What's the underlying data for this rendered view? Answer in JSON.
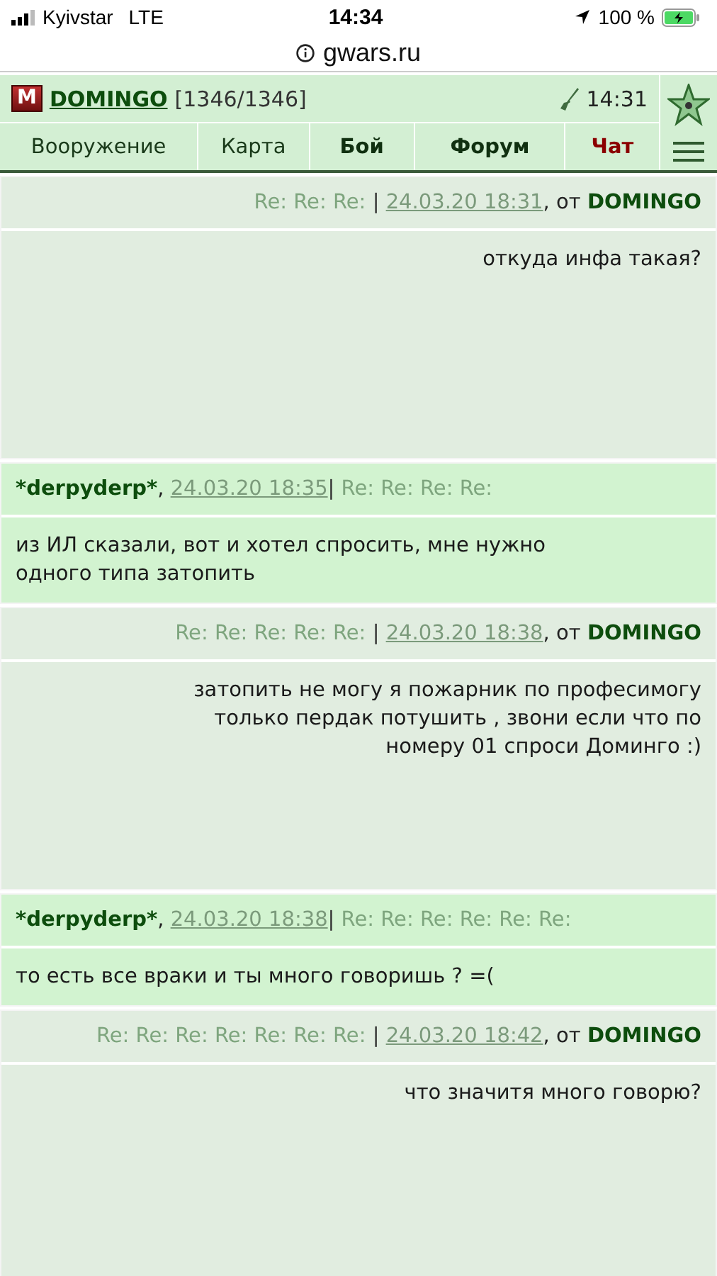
{
  "status_bar": {
    "carrier": "Kyivstar",
    "network": "LTE",
    "time": "14:34",
    "battery": "100 %"
  },
  "address_bar": {
    "url": "gwars.ru"
  },
  "header": {
    "logo": "M",
    "user": "DOMINGO",
    "hp": "[1346/1346]",
    "clock": "14:31"
  },
  "nav": [
    {
      "label": "Вооружение",
      "kind": "plain"
    },
    {
      "label": "Карта",
      "kind": "plain"
    },
    {
      "label": "Бой",
      "kind": "bold"
    },
    {
      "label": "Форум",
      "kind": "bold"
    },
    {
      "label": "Чат",
      "kind": "alert"
    }
  ],
  "messages": [
    {
      "kind": "mine",
      "meta": [
        {
          "kind": "subject",
          "text": "Re: Re: Re:"
        },
        {
          "kind": "sep",
          "text": "|"
        },
        {
          "kind": "date",
          "text": "24.03.20 18:31"
        },
        {
          "kind": "text",
          "text": ", от"
        },
        {
          "kind": "author",
          "text": "DOMINGO"
        }
      ],
      "body": "откуда инфа такая?"
    },
    {
      "kind": "other",
      "meta": [
        {
          "kind": "author",
          "text": "*derpyderp*"
        },
        {
          "kind": "text",
          "text": ","
        },
        {
          "kind": "date",
          "text": "24.03.20 18:35"
        },
        {
          "kind": "sep",
          "text": "|"
        },
        {
          "kind": "subject",
          "text": "Re: Re: Re: Re:"
        }
      ],
      "body": "из ИЛ сказали, вот и хотел спросить, мне нужно одного типа затопить"
    },
    {
      "kind": "mine",
      "meta": [
        {
          "kind": "subject",
          "text": "Re: Re: Re: Re: Re:"
        },
        {
          "kind": "sep",
          "text": "|"
        },
        {
          "kind": "date",
          "text": "24.03.20 18:38"
        },
        {
          "kind": "text",
          "text": ", от"
        },
        {
          "kind": "author",
          "text": "DOMINGO"
        }
      ],
      "body": "затопить не могу я пожарник по професимогу только пердак потушить , звони если что по номеру 01 спроси Доминго :)"
    },
    {
      "kind": "other",
      "meta": [
        {
          "kind": "author",
          "text": "*derpyderp*"
        },
        {
          "kind": "text",
          "text": ","
        },
        {
          "kind": "date",
          "text": "24.03.20 18:38"
        },
        {
          "kind": "sep",
          "text": "|"
        },
        {
          "kind": "subject",
          "text": "Re: Re: Re: Re: Re: Re:"
        }
      ],
      "body": "то есть все враки и ты много говоришь ? =("
    },
    {
      "kind": "mine",
      "meta": [
        {
          "kind": "subject",
          "text": "Re: Re: Re: Re: Re: Re: Re:"
        },
        {
          "kind": "sep",
          "text": "|"
        },
        {
          "kind": "date",
          "text": "24.03.20 18:42"
        },
        {
          "kind": "text",
          "text": ", от"
        },
        {
          "kind": "author",
          "text": "DOMINGO"
        }
      ],
      "body": "что значитя много говорю?"
    }
  ]
}
